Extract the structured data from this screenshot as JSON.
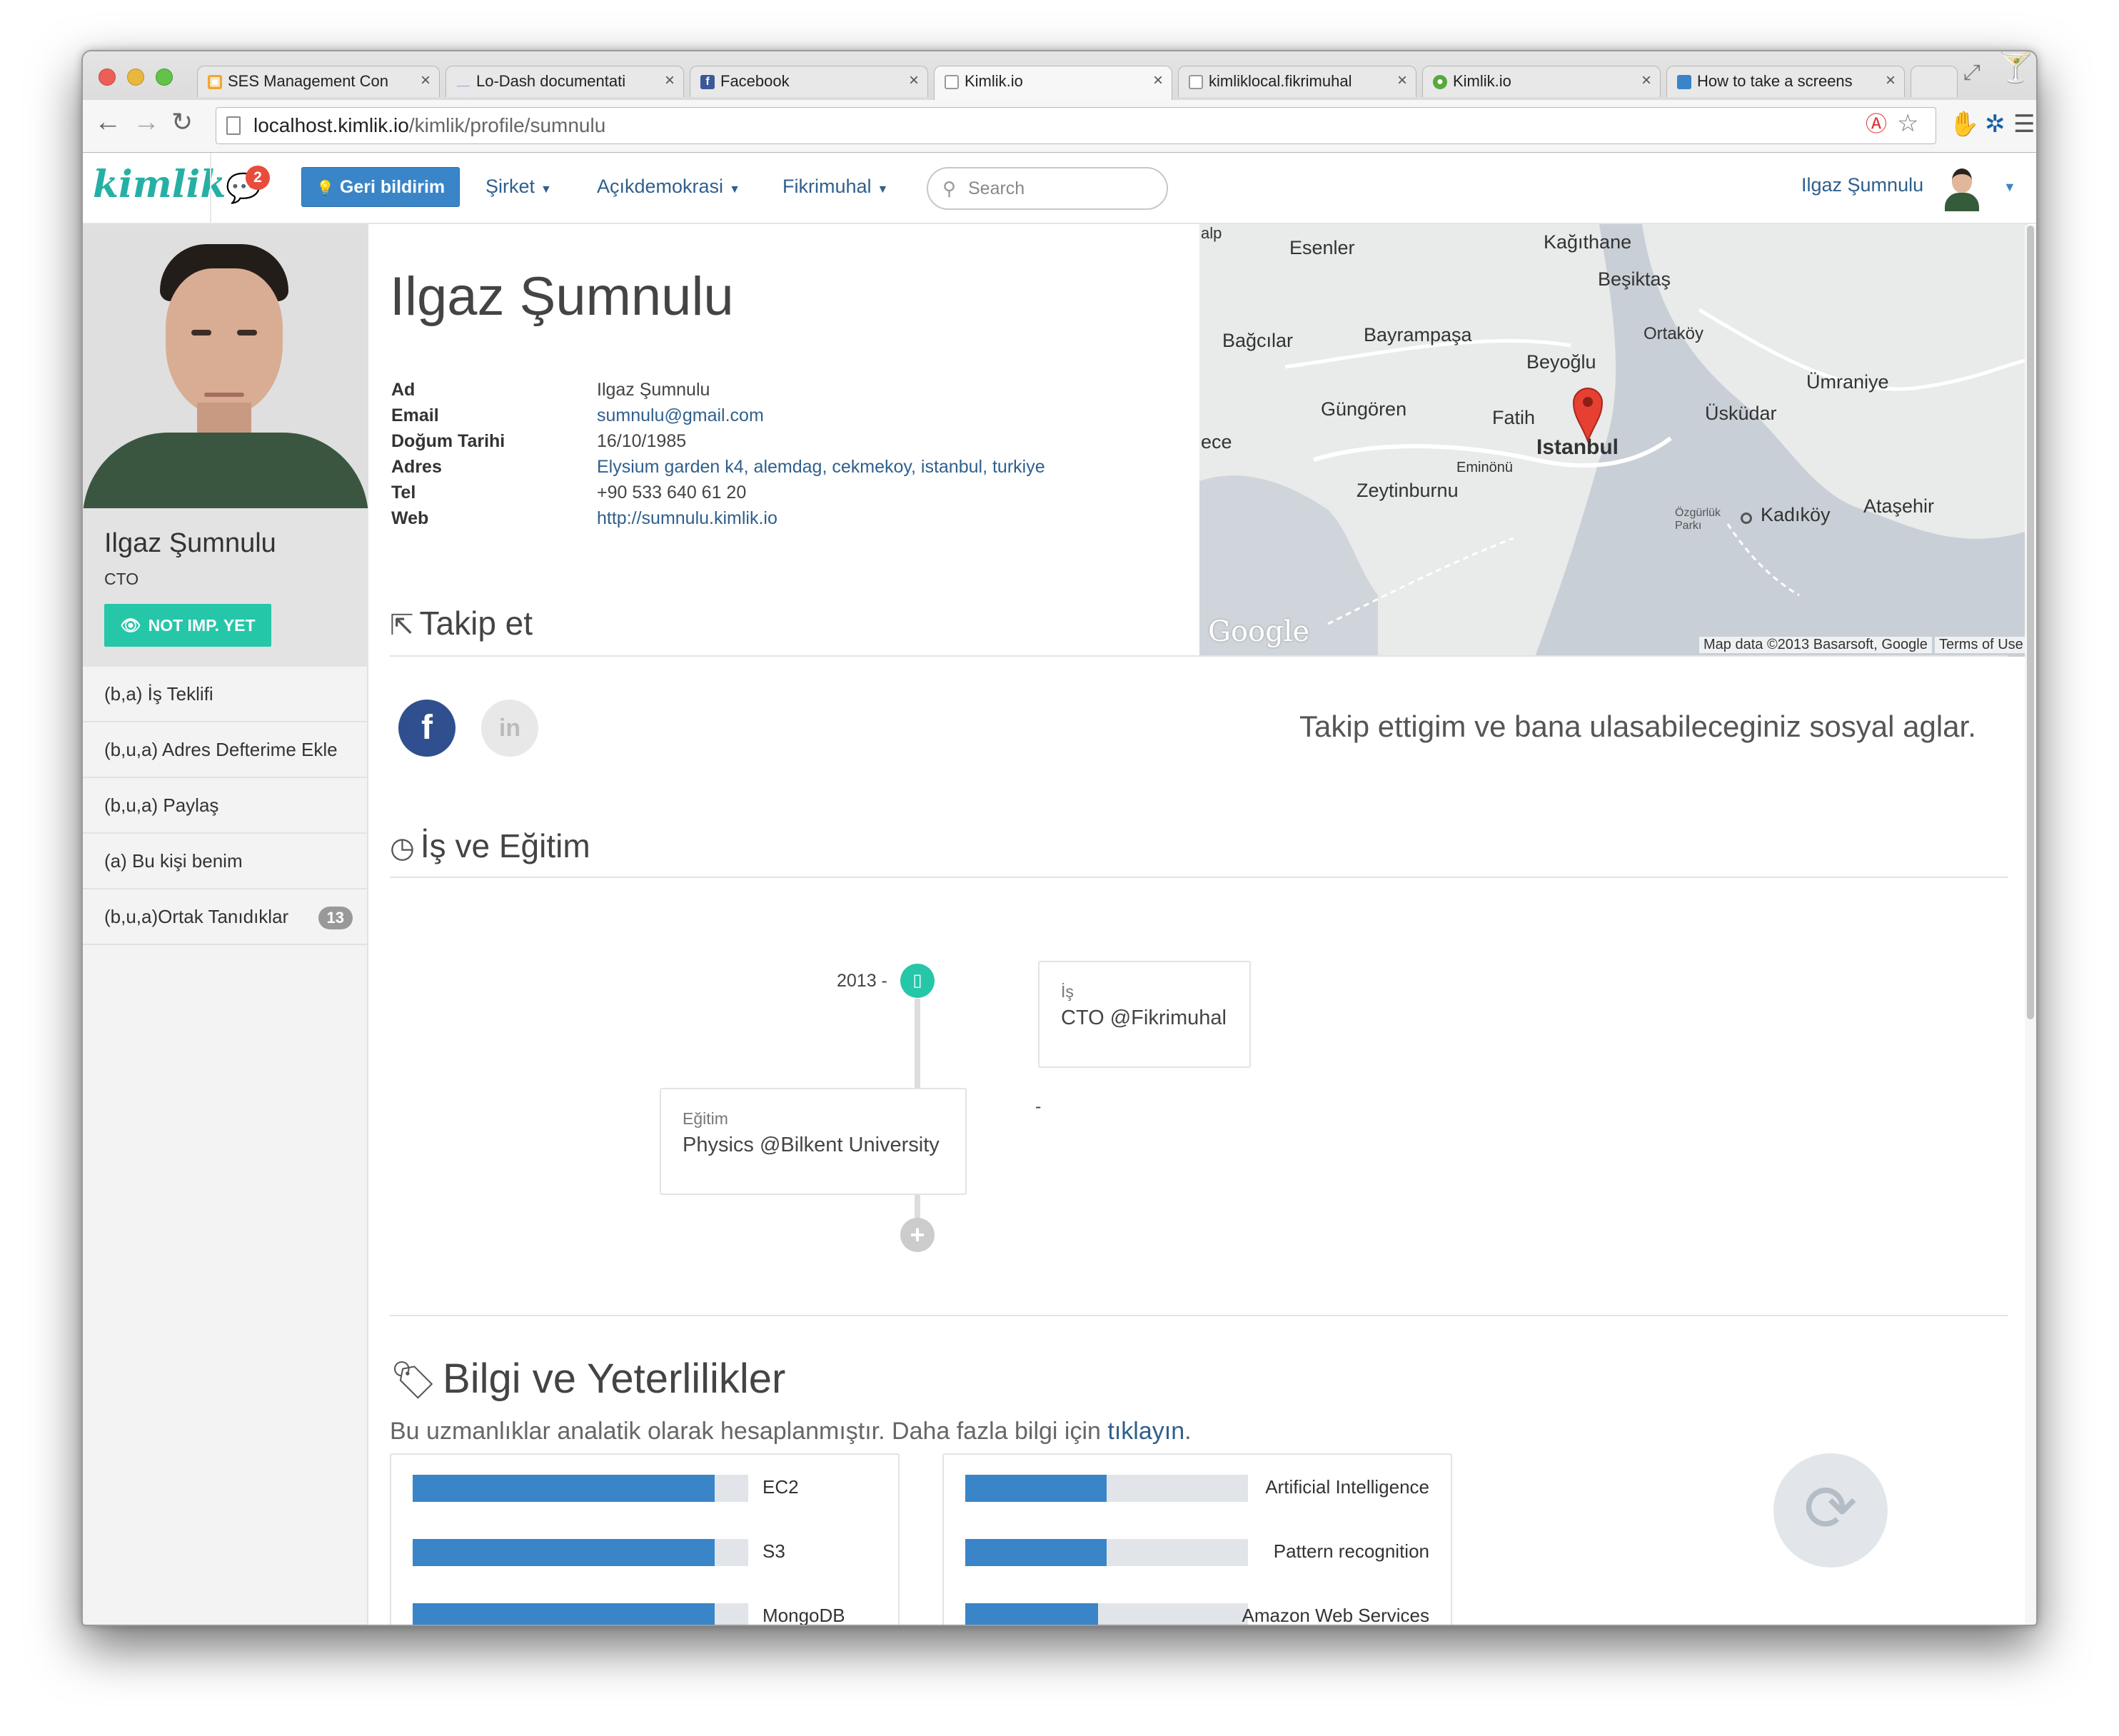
{
  "browser": {
    "tabs": [
      {
        "label": "SES Management Con",
        "icon": "package-icon",
        "color": "#f0a830"
      },
      {
        "label": "Lo-Dash documentati",
        "icon": "underscore-icon",
        "color": "#3a85c8"
      },
      {
        "label": "Facebook",
        "icon": "facebook-icon",
        "color": "#3b5998"
      },
      {
        "label": "Kimlik.io",
        "icon": "page-icon",
        "color": "#ffffff"
      },
      {
        "label": "kimliklocal.fikrimuhal",
        "icon": "page-icon",
        "color": "#ffffff"
      },
      {
        "label": "Kimlik.io",
        "icon": "kimlik-icon",
        "color": "#58a83c"
      },
      {
        "label": "How to take a screens",
        "icon": "page-icon",
        "color": "#3a85c8"
      }
    ],
    "url_host": "localhost.kimlik.io",
    "url_path": "/kimlik/profile/sumnulu"
  },
  "appnav": {
    "brand": "kimlik",
    "notifications": "2",
    "feedback": "Geri bildirim",
    "menus": [
      "Şirket",
      "Açıkdemokrasi",
      "Fikrimuhal"
    ],
    "search_placeholder": "Search",
    "user": "Ilgaz Şumnulu"
  },
  "sidebar": {
    "name": "Ilgaz Şumnulu",
    "role": "CTO",
    "status_button": "NOT IMP. YET",
    "items": [
      "(b,a) İş Teklifi",
      "(b,u,a) Adres Defterime Ekle",
      "(b,u,a) Paylaş",
      "(a) Bu kişi benim",
      "(b,u,a)Ortak Tanıdıklar"
    ],
    "mutual_count": "13"
  },
  "profile": {
    "title": "Ilgaz Şumnulu",
    "fields": [
      {
        "label": "Ad",
        "value": "Ilgaz Şumnulu"
      },
      {
        "label": "Email",
        "value": "sumnulu@gmail.com"
      },
      {
        "label": "Doğum Tarihi",
        "value": "16/10/1985"
      },
      {
        "label": "Adres",
        "value": "Elysium garden k4, alemdag, cekmekoy, istanbul, turkiye"
      },
      {
        "label": "Tel",
        "value": "+90 533 640 61 20"
      },
      {
        "label": "Web",
        "value": "http://sumnulu.kimlik.io"
      }
    ]
  },
  "map": {
    "labels": [
      "Esenler",
      "Kağıthane",
      "Beşiktaş",
      "Bağcılar",
      "Bayrampaşa",
      "Ortaköy",
      "Beyoğlu",
      "Ümraniye",
      "Güngören",
      "Fatih",
      "Üsküdar",
      "Istanbul",
      "Eminönü",
      "Zeytinburnu",
      "Kadıköy",
      "Ataşehir",
      "alp",
      "ece",
      "Özgürlük Parkı"
    ],
    "google": "Google",
    "attribution": "Map data ©2013 Basarsoft, Google",
    "terms": "Terms of Use"
  },
  "follow": {
    "heading": "Takip et",
    "note": "Takip ettigim ve bana ulasabileceginiz sosyal aglar."
  },
  "work": {
    "heading": "İş ve Eğitim",
    "entries": [
      {
        "year": "2013 -",
        "type": "İş",
        "title": "CTO @Fikrimuhal"
      },
      {
        "year": "-",
        "type": "Eğitim",
        "title": "Physics @Bilkent University"
      }
    ]
  },
  "skills": {
    "heading": "Bilgi ve Yeterlilikler",
    "subtitle": "Bu uzmanlıklar analatik olarak hesaplanmıştır. Daha fazla bilgi için",
    "subtitle_link": "tıklayın",
    "subtitle_end": ".",
    "col1": [
      {
        "name": "EC2",
        "level": 0.9
      },
      {
        "name": "S3",
        "level": 0.9
      },
      {
        "name": "MongoDB",
        "level": 0.9
      }
    ],
    "col2": [
      {
        "name": "Artificial Intelligence",
        "level": 0.5
      },
      {
        "name": "Pattern recognition",
        "level": 0.5
      },
      {
        "name": "Amazon Web Services",
        "level": 0.47
      }
    ]
  }
}
